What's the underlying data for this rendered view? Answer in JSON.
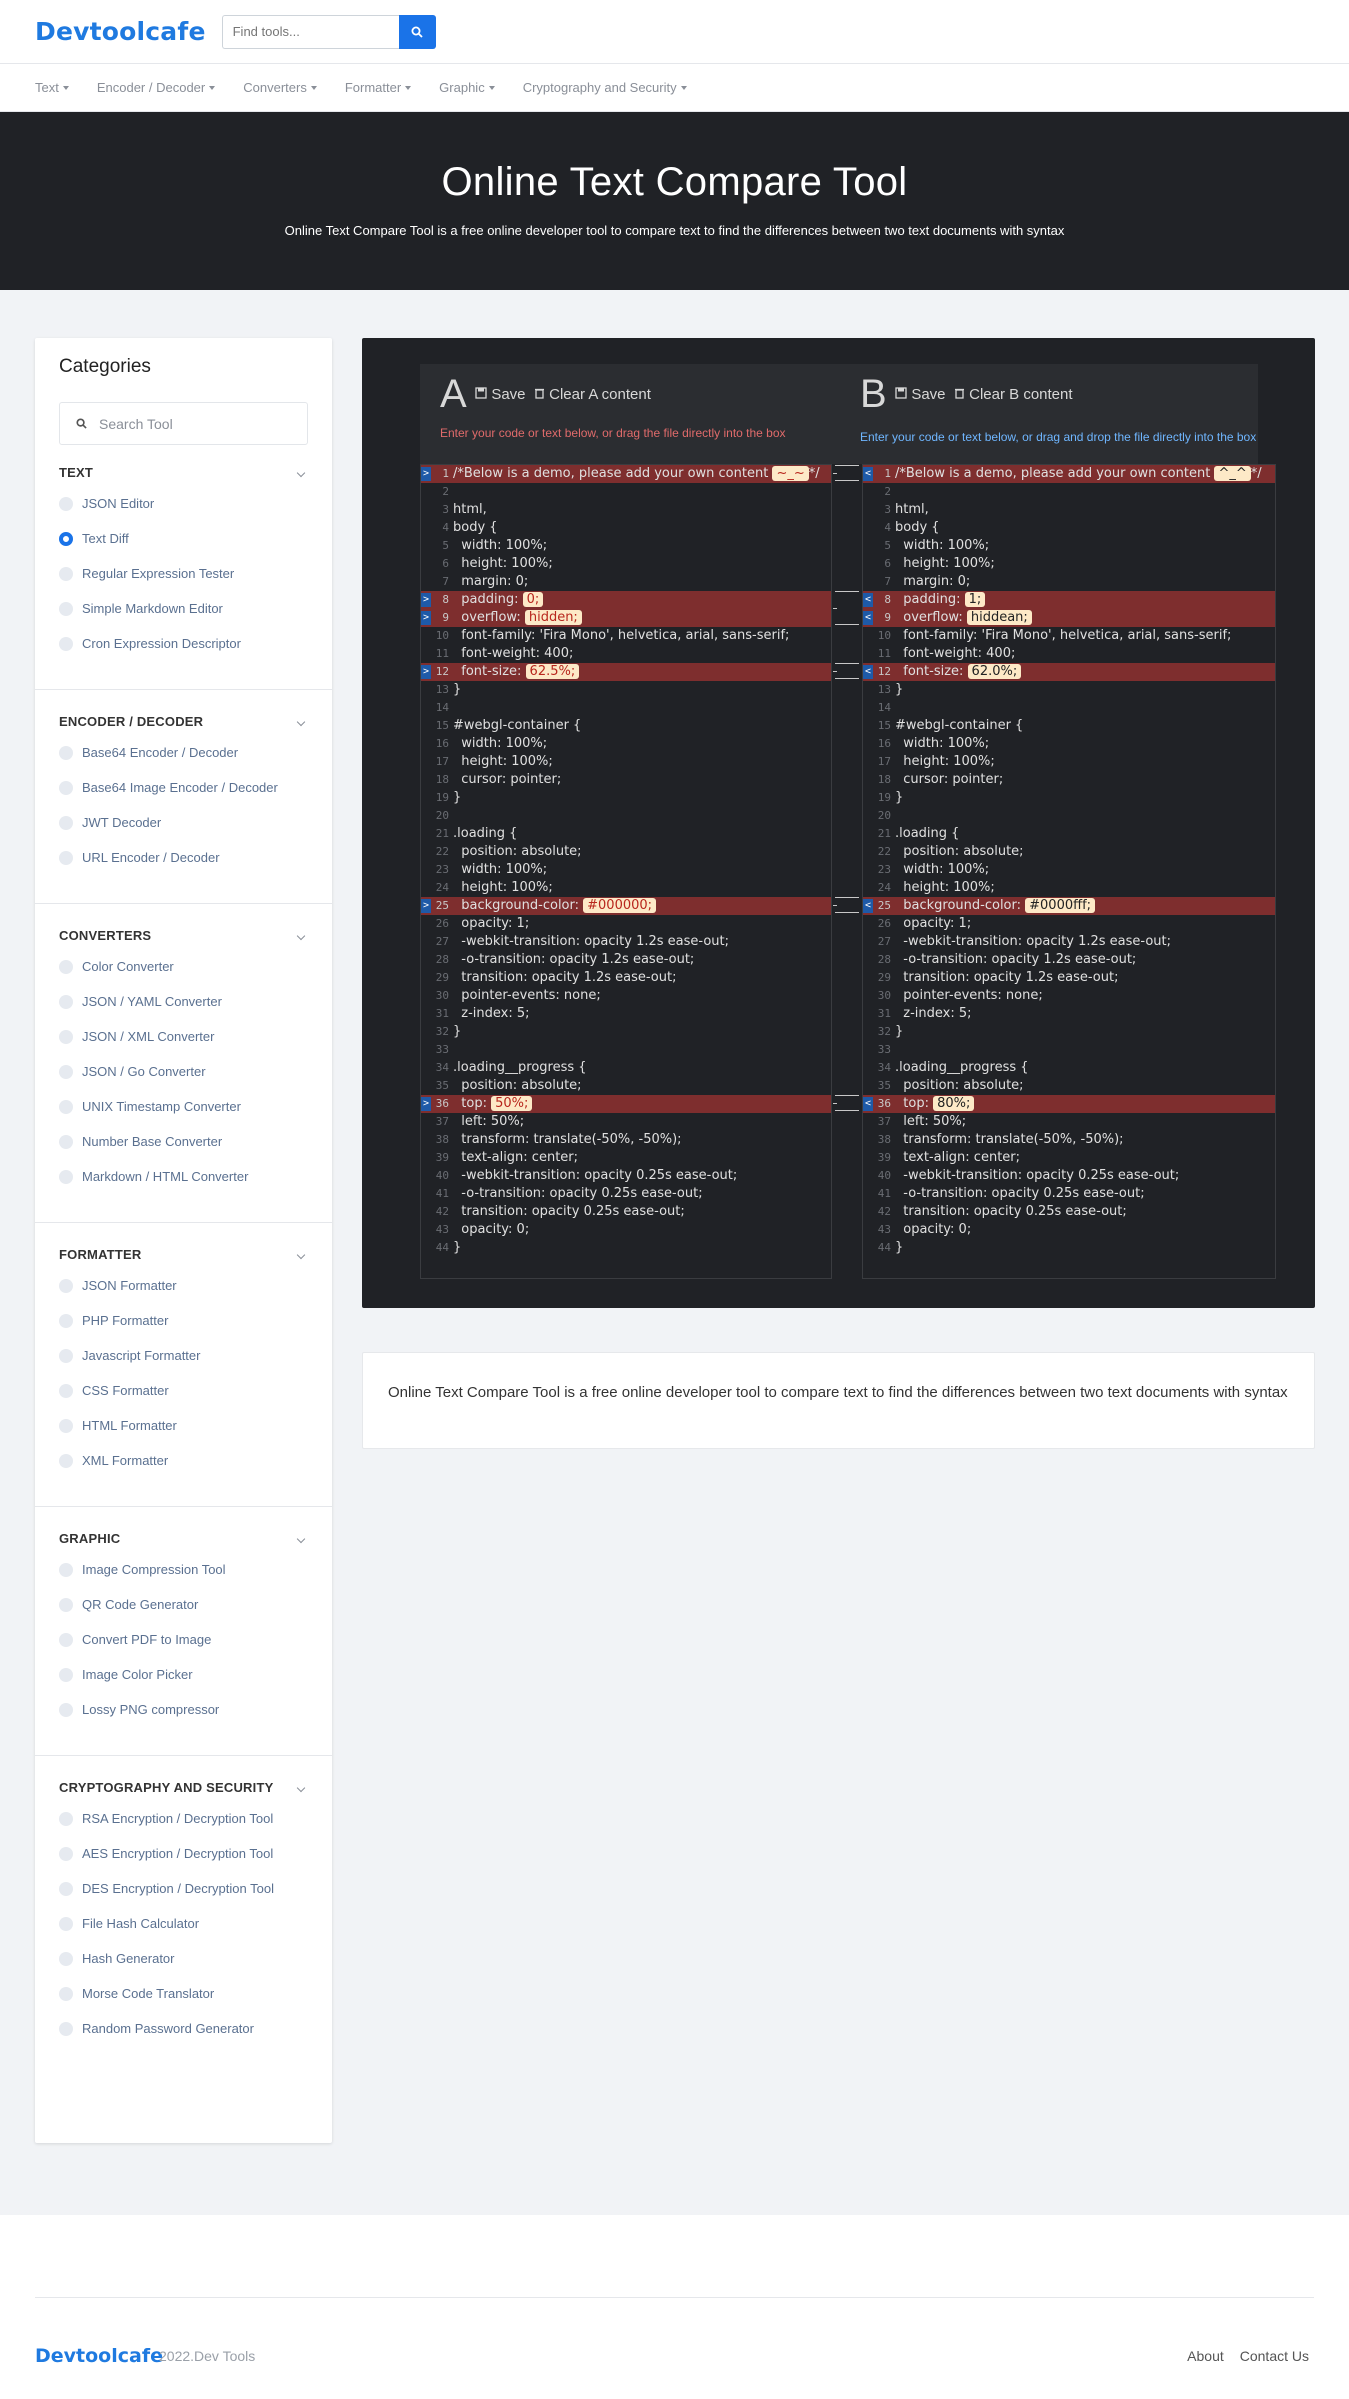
{
  "brand": {
    "logo": "Devtoolcafe",
    "accent": "#1a73e8"
  },
  "header": {
    "search_placeholder": "Find tools..."
  },
  "nav": [
    "Text",
    "Encoder / Decoder",
    "Converters",
    "Formatter",
    "Graphic",
    "Cryptography and Security"
  ],
  "hero": {
    "title": "Online Text Compare Tool",
    "subtitle": "Online Text Compare Tool is a free online developer tool to compare text to find the differences between two text documents with syntax"
  },
  "sidebar": {
    "title": "Categories",
    "search_placeholder": "Search Tool",
    "sections": [
      {
        "title": "TEXT",
        "items": [
          "JSON Editor",
          "Text Diff",
          "Regular Expression Tester",
          "Simple Markdown Editor",
          "Cron Expression Descriptor"
        ],
        "selected": 1
      },
      {
        "title": "ENCODER / DECODER",
        "items": [
          "Base64 Encoder / Decoder",
          "Base64 Image Encoder / Decoder",
          "JWT Decoder",
          "URL Encoder / Decoder"
        ]
      },
      {
        "title": "CONVERTERS",
        "items": [
          "Color Converter",
          "JSON / YAML Converter",
          "JSON / XML Converter",
          "JSON / Go Converter",
          "UNIX Timestamp Converter",
          "Number Base Converter",
          "Markdown / HTML Converter"
        ]
      },
      {
        "title": "FORMATTER",
        "items": [
          "JSON Formatter",
          "PHP Formatter",
          "Javascript Formatter",
          "CSS Formatter",
          "HTML Formatter",
          "XML Formatter"
        ]
      },
      {
        "title": "GRAPHIC",
        "items": [
          "Image Compression Tool",
          "QR Code Generator",
          "Convert PDF to Image",
          "Image Color Picker",
          "Lossy PNG compressor"
        ]
      },
      {
        "title": "CRYPTOGRAPHY AND SECURITY",
        "items": [
          "RSA Encryption / Decryption Tool",
          "AES Encryption / Decryption Tool",
          "DES Encryption / Decryption Tool",
          "File Hash Calculator",
          "Hash Generator",
          "Morse Code Translator",
          "Random Password Generator"
        ]
      }
    ]
  },
  "diff": {
    "a": {
      "letter": "A",
      "save": "Save",
      "clear": "Clear A content",
      "hint": "Enter your code or text below, or drag the file directly into the box"
    },
    "b": {
      "letter": "B",
      "save": "Save",
      "clear": "Clear B content",
      "hint": "Enter your code or text below, or drag and drop the file directly into the box"
    },
    "left_lines": [
      "/*Below is a demo, please add your own content ~_~*/",
      "",
      "html,",
      "body {",
      "  width: 100%;",
      "  height: 100%;",
      "  margin: 0;",
      "  padding: 0;",
      "  overflow: hidden;",
      "  font-family: 'Fira Mono', helvetica, arial, sans-serif;",
      "  font-weight: 400;",
      "  font-size: 62.5%;",
      "}",
      "",
      "#webgl-container {",
      "  width: 100%;",
      "  height: 100%;",
      "  cursor: pointer;",
      "}",
      "",
      ".loading {",
      "  position: absolute;",
      "  width: 100%;",
      "  height: 100%;",
      "  background-color: #000000;",
      "  opacity: 1;",
      "  -webkit-transition: opacity 1.2s ease-out;",
      "  -o-transition: opacity 1.2s ease-out;",
      "  transition: opacity 1.2s ease-out;",
      "  pointer-events: none;",
      "  z-index: 5;",
      "}",
      "",
      ".loading__progress {",
      "  position: absolute;",
      "  top: 50%;",
      "  left: 50%;",
      "  transform: translate(-50%, -50%);",
      "  text-align: center;",
      "  -webkit-transition: opacity 0.25s ease-out;",
      "  -o-transition: opacity 0.25s ease-out;",
      "  transition: opacity 0.25s ease-out;",
      "  opacity: 0;",
      "}"
    ],
    "right_lines": [
      "/*Below is a demo, please add your own content ^_^*/",
      "",
      "html,",
      "body {",
      "  width: 100%;",
      "  height: 100%;",
      "  margin: 0;",
      "  padding: 1;",
      "  overflow: hiddean;",
      "  font-family: 'Fira Mono', helvetica, arial, sans-serif;",
      "  font-weight: 400;",
      "  font-size: 62.0%;",
      "}",
      "",
      "#webgl-container {",
      "  width: 100%;",
      "  height: 100%;",
      "  cursor: pointer;",
      "}",
      "",
      ".loading {",
      "  position: absolute;",
      "  width: 100%;",
      "  height: 100%;",
      "  background-color: #0000fff;",
      "  opacity: 1;",
      "  -webkit-transition: opacity 1.2s ease-out;",
      "  -o-transition: opacity 1.2s ease-out;",
      "  transition: opacity 1.2s ease-out;",
      "  pointer-events: none;",
      "  z-index: 5;",
      "}",
      "",
      ".loading__progress {",
      "  position: absolute;",
      "  top: 80%;",
      "  left: 50%;",
      "  transform: translate(-50%, -50%);",
      "  text-align: center;",
      "  -webkit-transition: opacity 0.25s ease-out;",
      "  -o-transition: opacity 0.25s ease-out;",
      "  transition: opacity 0.25s ease-out;",
      "  opacity: 0;",
      "}"
    ],
    "changed_lines": [
      1,
      8,
      9,
      12,
      25,
      36
    ],
    "left_highlights": {
      "1": "~_~",
      "8": "0;",
      "9": "hidden;",
      "12": "62.5%;",
      "25": "#000000;",
      "36": "50%;"
    },
    "right_highlights": {
      "1": "^_^",
      "8": "1;",
      "9": "hiddean;",
      "12": "62.0%;",
      "25": "#0000fff;",
      "36": "80%;"
    }
  },
  "info_text": "Online Text Compare Tool is a free online developer tool to compare text to find the differences between two text documents with syntax",
  "footer": {
    "logo": "Devtoolcafe",
    "copyright": "2022.Dev Tools",
    "links": [
      "About",
      "Contact Us"
    ]
  }
}
